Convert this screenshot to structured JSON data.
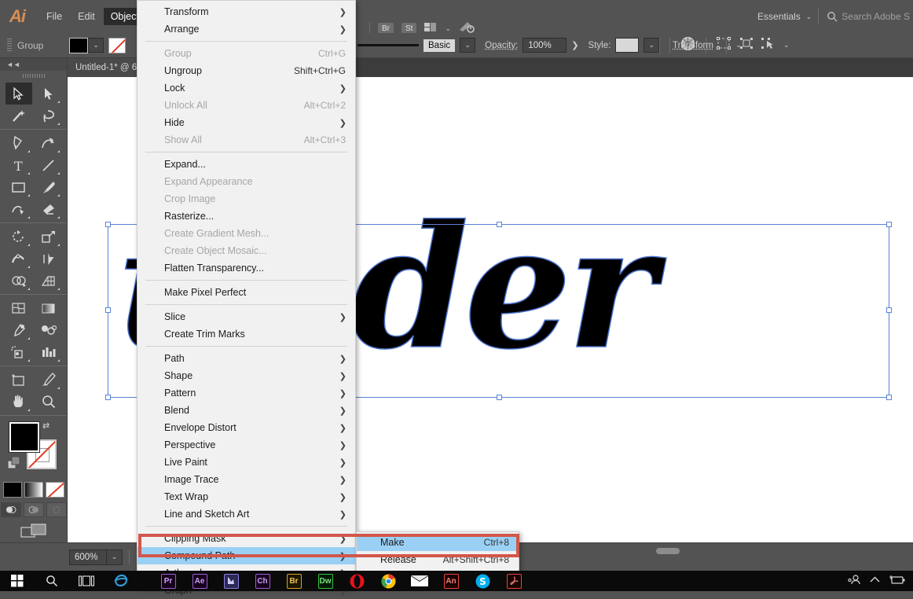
{
  "app": {
    "logo": "Ai",
    "menus": [
      "File",
      "Edit",
      "Object"
    ],
    "active_menu": "Object",
    "workspace": "Essentials",
    "search_placeholder": "Search Adobe S"
  },
  "control_bar": {
    "selection_label": "Group",
    "stroke_profile": "Basic",
    "opacity_label": "Opacity:",
    "opacity_value": "100%",
    "style_label": "Style:",
    "transform_label": "Transform",
    "bridge_button": "Br",
    "stock_button": "St"
  },
  "document": {
    "tab_title": "Untitled-1* @ 6",
    "artwork_text": "under",
    "zoom": "600%"
  },
  "object_menu": {
    "items": [
      {
        "label": "Transform",
        "shortcut": "",
        "submenu": true,
        "disabled": false
      },
      {
        "label": "Arrange",
        "shortcut": "",
        "submenu": true,
        "disabled": false
      },
      {
        "sep": true
      },
      {
        "label": "Group",
        "shortcut": "Ctrl+G",
        "submenu": false,
        "disabled": true
      },
      {
        "label": "Ungroup",
        "shortcut": "Shift+Ctrl+G",
        "submenu": false,
        "disabled": false
      },
      {
        "label": "Lock",
        "shortcut": "",
        "submenu": true,
        "disabled": false
      },
      {
        "label": "Unlock All",
        "shortcut": "Alt+Ctrl+2",
        "submenu": false,
        "disabled": true
      },
      {
        "label": "Hide",
        "shortcut": "",
        "submenu": true,
        "disabled": false
      },
      {
        "label": "Show All",
        "shortcut": "Alt+Ctrl+3",
        "submenu": false,
        "disabled": true
      },
      {
        "sep": true
      },
      {
        "label": "Expand...",
        "shortcut": "",
        "submenu": false,
        "disabled": false
      },
      {
        "label": "Expand Appearance",
        "shortcut": "",
        "submenu": false,
        "disabled": true
      },
      {
        "label": "Crop Image",
        "shortcut": "",
        "submenu": false,
        "disabled": true
      },
      {
        "label": "Rasterize...",
        "shortcut": "",
        "submenu": false,
        "disabled": false
      },
      {
        "label": "Create Gradient Mesh...",
        "shortcut": "",
        "submenu": false,
        "disabled": true
      },
      {
        "label": "Create Object Mosaic...",
        "shortcut": "",
        "submenu": false,
        "disabled": true
      },
      {
        "label": "Flatten Transparency...",
        "shortcut": "",
        "submenu": false,
        "disabled": false
      },
      {
        "sep": true
      },
      {
        "label": "Make Pixel Perfect",
        "shortcut": "",
        "submenu": false,
        "disabled": false
      },
      {
        "sep": true
      },
      {
        "label": "Slice",
        "shortcut": "",
        "submenu": true,
        "disabled": false
      },
      {
        "label": "Create Trim Marks",
        "shortcut": "",
        "submenu": false,
        "disabled": false
      },
      {
        "sep": true
      },
      {
        "label": "Path",
        "shortcut": "",
        "submenu": true,
        "disabled": false
      },
      {
        "label": "Shape",
        "shortcut": "",
        "submenu": true,
        "disabled": false
      },
      {
        "label": "Pattern",
        "shortcut": "",
        "submenu": true,
        "disabled": false
      },
      {
        "label": "Blend",
        "shortcut": "",
        "submenu": true,
        "disabled": false
      },
      {
        "label": "Envelope Distort",
        "shortcut": "",
        "submenu": true,
        "disabled": false
      },
      {
        "label": "Perspective",
        "shortcut": "",
        "submenu": true,
        "disabled": false
      },
      {
        "label": "Live Paint",
        "shortcut": "",
        "submenu": true,
        "disabled": false
      },
      {
        "label": "Image Trace",
        "shortcut": "",
        "submenu": true,
        "disabled": false
      },
      {
        "label": "Text Wrap",
        "shortcut": "",
        "submenu": true,
        "disabled": false
      },
      {
        "label": "Line and Sketch Art",
        "shortcut": "",
        "submenu": true,
        "disabled": false
      },
      {
        "sep": true
      },
      {
        "label": "Clipping Mask",
        "shortcut": "",
        "submenu": true,
        "disabled": false
      },
      {
        "label": "Compound Path",
        "shortcut": "",
        "submenu": true,
        "disabled": false,
        "highlighted": true
      },
      {
        "label": "Artboards",
        "shortcut": "",
        "submenu": true,
        "disabled": false
      },
      {
        "label": "Graph",
        "shortcut": "",
        "submenu": true,
        "disabled": false
      }
    ]
  },
  "compound_path_submenu": {
    "items": [
      {
        "label": "Make",
        "shortcut": "Ctrl+8",
        "highlighted": true
      },
      {
        "label": "Release",
        "shortcut": "Alt+Shift+Ctrl+8",
        "highlighted": false
      }
    ]
  },
  "highlight": {
    "color": "#d1574a"
  },
  "toolbox": {
    "tools": [
      "selection-tool",
      "direct-selection-tool",
      "magic-wand-tool",
      "lasso-tool",
      "pen-tool",
      "curvature-tool",
      "type-tool",
      "line-segment-tool",
      "rectangle-tool",
      "paintbrush-tool",
      "shaper-tool",
      "eraser-tool",
      "rotate-tool",
      "scale-tool",
      "width-tool",
      "free-transform-tool",
      "shape-builder-tool",
      "perspective-grid-tool",
      "mesh-tool",
      "gradient-tool",
      "eyedropper-tool",
      "blend-tool",
      "symbol-sprayer-tool",
      "column-graph-tool",
      "artboard-tool",
      "slice-tool",
      "hand-tool",
      "zoom-tool"
    ],
    "active_tool": "selection-tool",
    "fill_color": "#000000",
    "stroke_color": "none"
  },
  "taskbar": {
    "apps": [
      "Pr",
      "Ae",
      "Ai",
      "Ch",
      "Br",
      "Dw",
      "Opera",
      "Chrome",
      "Mail",
      "An",
      "Skype",
      "Acrobat"
    ]
  }
}
